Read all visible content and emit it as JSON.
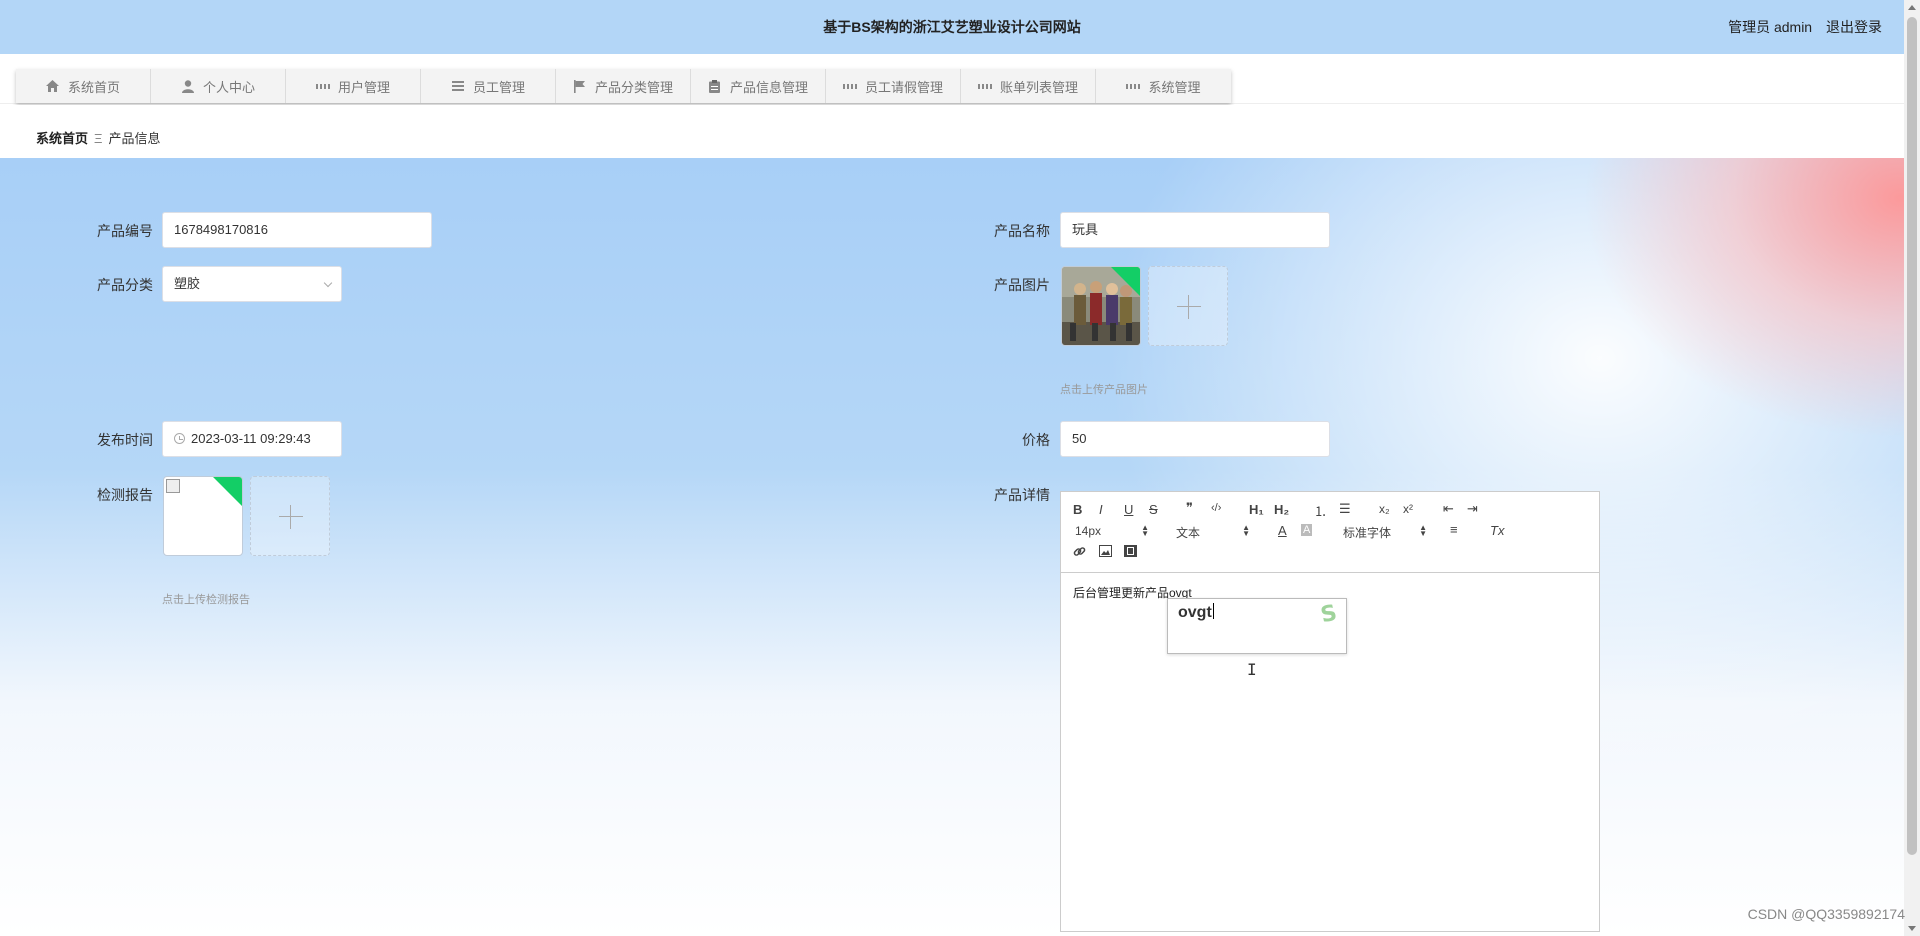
{
  "header": {
    "title": "基于BS架构的浙江艾艺塑业设计公司网站",
    "user_label": "管理员 admin",
    "logout_label": "退出登录"
  },
  "nav": {
    "items": [
      {
        "label": "系统首页",
        "icon": "home-icon"
      },
      {
        "label": "个人中心",
        "icon": "person-icon"
      },
      {
        "label": "用户管理",
        "icon": "grid-icon"
      },
      {
        "label": "员工管理",
        "icon": "list-icon"
      },
      {
        "label": "产品分类管理",
        "icon": "flag-icon"
      },
      {
        "label": "产品信息管理",
        "icon": "clipboard-icon"
      },
      {
        "label": "员工请假管理",
        "icon": "grid-icon"
      },
      {
        "label": "账单列表管理",
        "icon": "grid-icon"
      },
      {
        "label": "系统管理",
        "icon": "grid-icon"
      }
    ]
  },
  "breadcrumb": {
    "home": "系统首页",
    "separator": "Ξ",
    "current": "产品信息"
  },
  "form": {
    "product_no": {
      "label": "产品编号",
      "value": "1678498170816"
    },
    "product_name": {
      "label": "产品名称",
      "value": "玩具"
    },
    "category": {
      "label": "产品分类",
      "value": "塑胶"
    },
    "product_image": {
      "label": "产品图片",
      "hint": "点击上传产品图片"
    },
    "publish_time": {
      "label": "发布时间",
      "value": "2023-03-11 09:29:43"
    },
    "price": {
      "label": "价格",
      "value": "50"
    },
    "report": {
      "label": "检测报告",
      "hint": "点击上传检测报告"
    },
    "detail": {
      "label": "产品详情"
    }
  },
  "editor": {
    "toolbar": {
      "bold": "B",
      "italic": "I",
      "underline": "U",
      "strike": "S",
      "quote": "❞",
      "code": "‹/›",
      "h1": "H₁",
      "h2": "H₂",
      "ordered_list": "⒈",
      "bullet_list": "☰",
      "sub": "x₂",
      "sup": "x²",
      "indent_left": "⇤",
      "indent_right": "⇥",
      "size": "14px",
      "header": "文本",
      "color": "A",
      "background": "A",
      "font": "标准字体",
      "align": "≡",
      "clean": "Tx",
      "link": "🔗",
      "image": "▣",
      "video": "▦"
    },
    "content": "后台管理更新产品ovgt",
    "ime_text": "ovgt"
  },
  "watermark": "CSDN @QQ3359892174"
}
